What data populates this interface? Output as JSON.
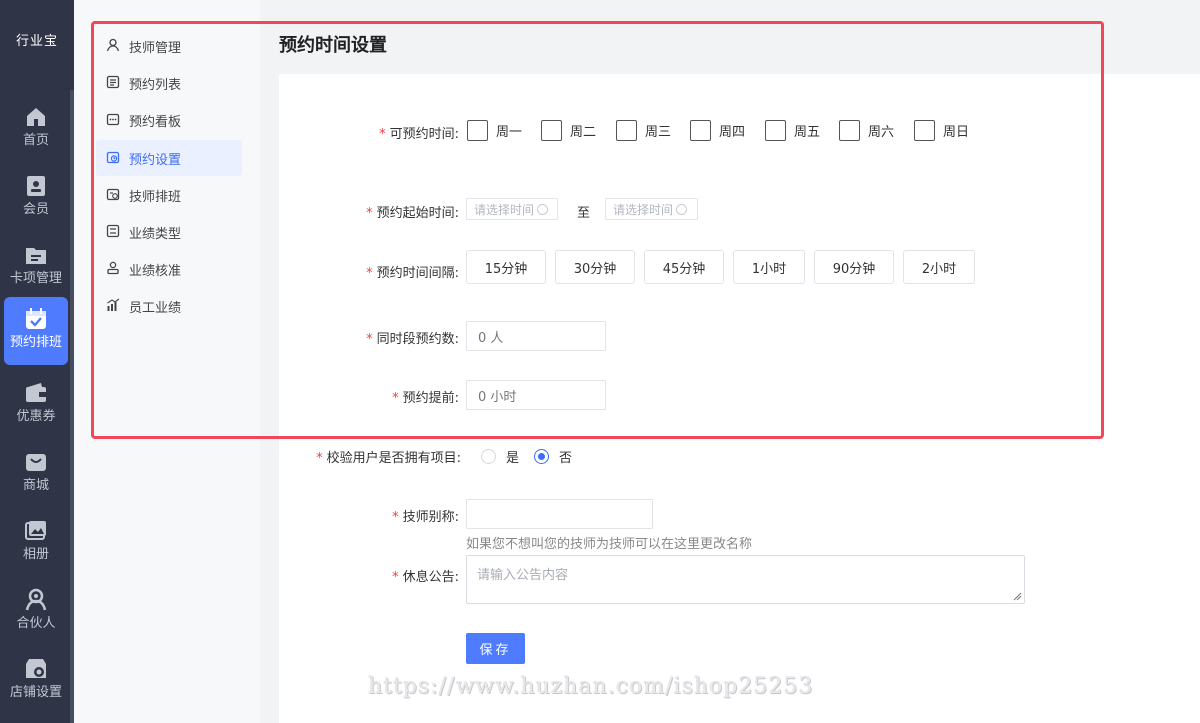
{
  "brand": {
    "logo_text": "行业宝"
  },
  "rail": {
    "items": [
      {
        "label": "首页",
        "icon": "home-icon"
      },
      {
        "label": "会员",
        "icon": "member-card-icon"
      },
      {
        "label": "卡项管理",
        "icon": "folder-icon"
      },
      {
        "label": "预约排班",
        "icon": "calendar-check-icon",
        "active": true
      },
      {
        "label": "优惠券",
        "icon": "wallet-icon"
      },
      {
        "label": "商城",
        "icon": "bag-icon"
      },
      {
        "label": "相册",
        "icon": "album-icon"
      },
      {
        "label": "合伙人",
        "icon": "partner-icon"
      },
      {
        "label": "店铺设置",
        "icon": "store-settings-icon"
      }
    ]
  },
  "submenu": {
    "items": [
      {
        "label": "技师管理",
        "icon": "user-icon"
      },
      {
        "label": "预约列表",
        "icon": "list-icon"
      },
      {
        "label": "预约看板",
        "icon": "board-icon"
      },
      {
        "label": "预约设置",
        "icon": "calendar-clock-icon",
        "active": true
      },
      {
        "label": "技师排班",
        "icon": "schedule-icon"
      },
      {
        "label": "业绩类型",
        "icon": "type-icon"
      },
      {
        "label": "业绩核准",
        "icon": "approve-icon"
      },
      {
        "label": "员工业绩",
        "icon": "bar-chart-icon"
      }
    ]
  },
  "page": {
    "title": "预约时间设置"
  },
  "form": {
    "available_time": {
      "label": "可预约时间:",
      "days": [
        "周一",
        "周二",
        "周三",
        "周四",
        "周五",
        "周六",
        "周日"
      ]
    },
    "start_time": {
      "label": "预约起始时间:",
      "from_placeholder": "请选择时间",
      "separator": "至",
      "to_placeholder": "请选择时间"
    },
    "interval": {
      "label": "预约时间间隔:",
      "options": [
        "15分钟",
        "30分钟",
        "45分钟",
        "1小时",
        "90分钟",
        "2小时"
      ]
    },
    "concurrent": {
      "label": "同时段预约数:",
      "value": "0 人"
    },
    "advance": {
      "label": "预约提前:",
      "value": "0 小时"
    },
    "verify_project": {
      "label": "校验用户是否拥有项目:",
      "options": [
        "是",
        "否"
      ],
      "selected": "否"
    },
    "tech_alias": {
      "label": "技师别称:",
      "value": "",
      "hint": "如果您不想叫您的技师为技师可以在这里更改名称"
    },
    "rest_notice": {
      "label": "休息公告:",
      "placeholder": "请输入公告内容"
    },
    "save_label": "保存"
  },
  "watermark": "https://www.huzhan.com/ishop25253",
  "colors": {
    "accent": "#4f7cff",
    "sidebar": "#2f3447",
    "highlight": "#f0485a",
    "required": "#f23c3c"
  }
}
